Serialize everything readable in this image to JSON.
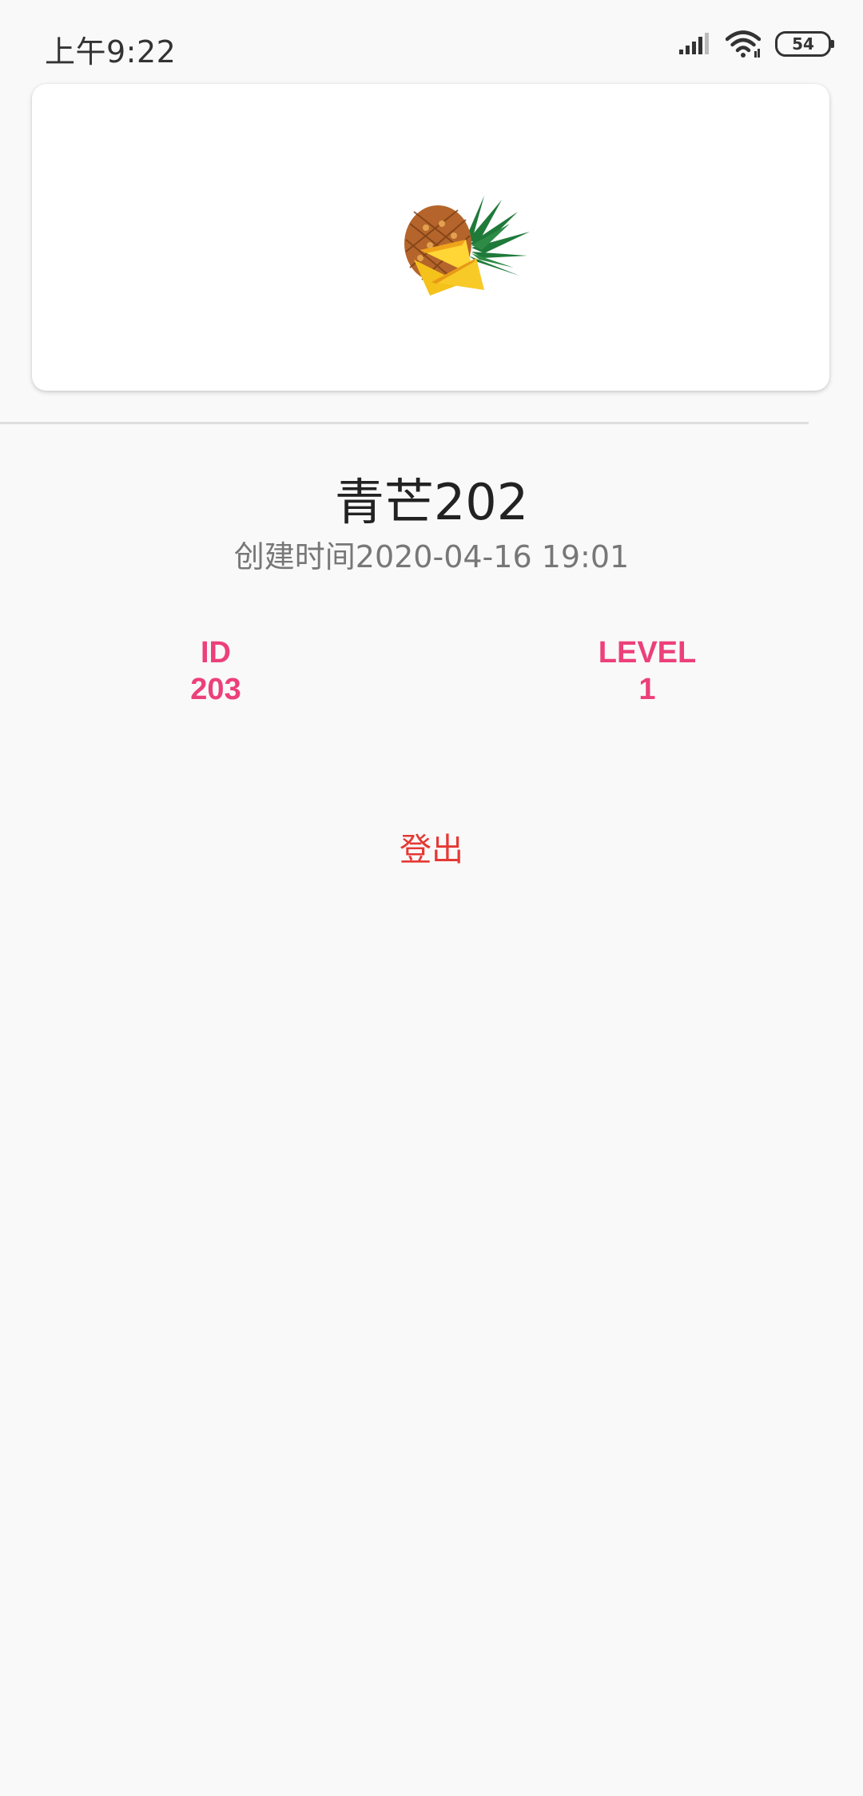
{
  "status_bar": {
    "time": "上午9:22",
    "battery": "54"
  },
  "profile": {
    "name": "青芒202",
    "created_time": "创建时间2020-04-16 19:01",
    "image_icon": "pineapple-icon"
  },
  "stats": {
    "id_label": "ID",
    "id_value": "203",
    "level_label": "LEVEL",
    "level_value": "1"
  },
  "actions": {
    "logout_label": "登出"
  },
  "colors": {
    "accent_pink": "#ec407a",
    "logout_red": "#e53935",
    "background": "#f9f9f9"
  }
}
